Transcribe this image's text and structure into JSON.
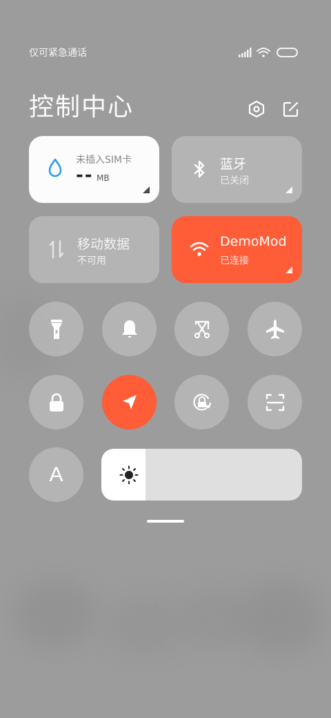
{
  "status": {
    "carrier_text": "仅可紧急通话",
    "icons": [
      "signal-icon",
      "wifi-icon",
      "battery-icon"
    ]
  },
  "header": {
    "title": "控制中心",
    "settings_icon": "settings-hex-icon",
    "edit_icon": "edit-icon"
  },
  "tiles": {
    "sim": {
      "label": "未插入SIM卡",
      "value": "--",
      "unit": "MB",
      "icon": "water-drop-icon"
    },
    "bluetooth": {
      "title": "蓝牙",
      "status": "已关闭",
      "icon": "bluetooth-icon"
    },
    "mobile_data": {
      "title": "移动数据",
      "status": "不可用",
      "icon": "data-transfer-icon"
    },
    "wifi": {
      "title": "DemoMod",
      "status": "已连接",
      "icon": "wifi-icon"
    }
  },
  "toggles_row1": [
    "flashlight-icon",
    "bell-icon",
    "screenshot-icon",
    "airplane-icon"
  ],
  "toggles_row2": [
    "lock-icon",
    "location-icon",
    "rotation-lock-icon",
    "scanner-icon"
  ],
  "font_toggle": {
    "label": "A"
  },
  "brightness": {
    "level": 0.22,
    "icon": "sun-icon"
  },
  "colors": {
    "accent": "#ff5c38",
    "background": "#9c9c9c",
    "tile_glass": "#c8c8c8",
    "tile_light": "#ffffff"
  }
}
